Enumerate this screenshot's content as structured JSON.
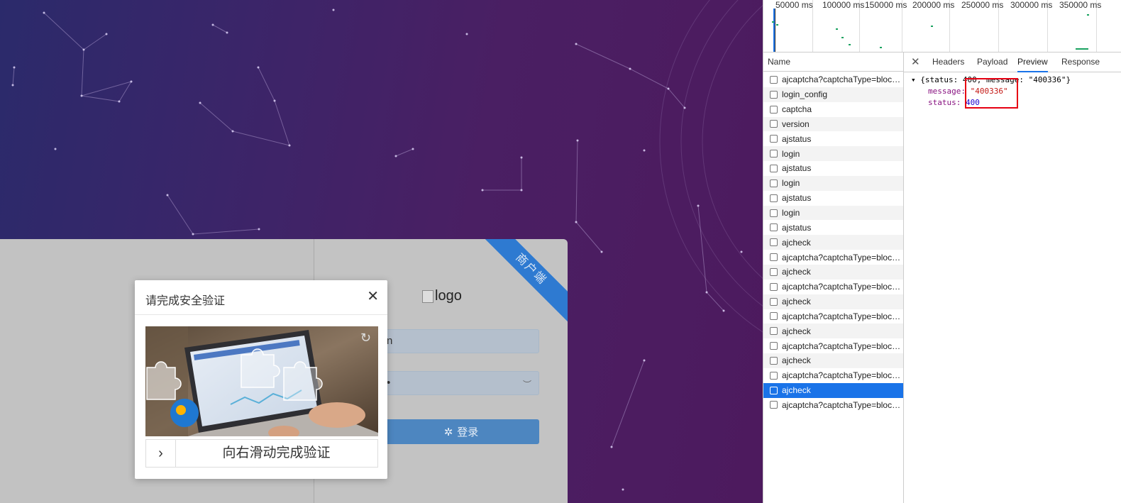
{
  "login": {
    "corner_label": "商户端",
    "logo_alt": "logo",
    "username_value": "n",
    "password_value": "•",
    "login_button": "登录",
    "login_icon": "spinner-icon"
  },
  "captcha": {
    "title": "请完成安全验证",
    "slider_hint": "向右滑动完成验证",
    "close_icon": "close-icon",
    "refresh_icon": "refresh-icon",
    "handle_icon": "chevron-right-icon"
  },
  "devtools": {
    "timeline_ticks": [
      "50000 ms",
      "100000 ms",
      "150000 ms",
      "200000 ms",
      "250000 ms",
      "300000 ms",
      "350000 ms"
    ],
    "name_header": "Name",
    "requests": [
      "ajcaptcha?captchaType=block...",
      "login_config",
      "captcha",
      "version",
      "ajstatus",
      "login",
      "ajstatus",
      "login",
      "ajstatus",
      "login",
      "ajstatus",
      "ajcheck",
      "ajcaptcha?captchaType=block...",
      "ajcheck",
      "ajcaptcha?captchaType=block...",
      "ajcheck",
      "ajcaptcha?captchaType=block...",
      "ajcheck",
      "ajcaptcha?captchaType=block...",
      "ajcheck",
      "ajcaptcha?captchaType=block...",
      "ajcheck",
      "ajcaptcha?captchaType=block..."
    ],
    "selected_index": 21,
    "tabs": [
      "Headers",
      "Payload",
      "Preview",
      "Response"
    ],
    "active_tab": "Preview",
    "preview": {
      "summary": "{status: 400, message: \"400336\"}",
      "message_key": "message:",
      "message_value": "\"400336\"",
      "status_key": "status:",
      "status_value": "400"
    }
  }
}
